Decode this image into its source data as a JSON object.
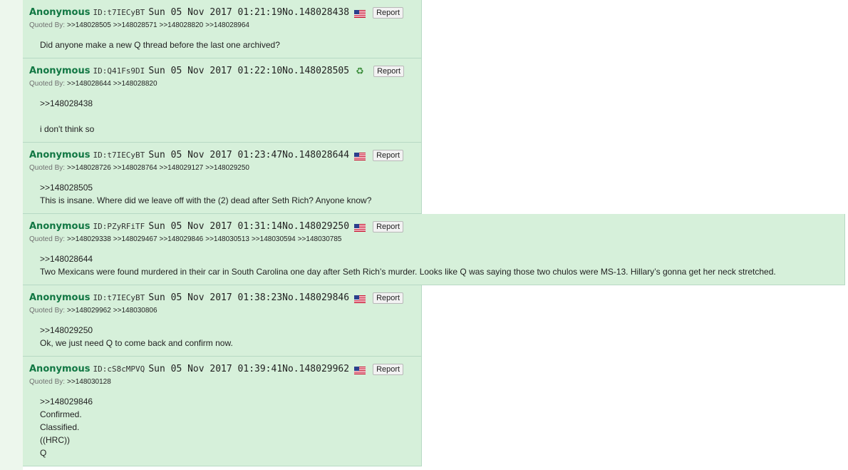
{
  "report_label": "Report",
  "quoted_by_label": "Quoted By:",
  "posts": [
    {
      "name": "Anonymous",
      "id": "ID:t7IECyBT",
      "datetime": "Sun 05 Nov 2017 01:21:19",
      "no": "No.148028438",
      "marker": "us-flag-icon",
      "quoted_by": [
        ">>148028505",
        ">>148028571",
        ">>148028820",
        ">>148028964"
      ],
      "lines": [
        "Did anyone make a new Q thread before the last one archived?"
      ]
    },
    {
      "name": "Anonymous",
      "id": "ID:Q41Fs9DI",
      "datetime": "Sun 05 Nov 2017 01:22:10",
      "no": "No.148028505",
      "marker": "recycle-icon",
      "quoted_by": [
        ">>148028644",
        ">>148028820"
      ],
      "lines": [
        ">>148028438",
        "",
        "i don't think so"
      ]
    },
    {
      "name": "Anonymous",
      "id": "ID:t7IECyBT",
      "datetime": "Sun 05 Nov 2017 01:23:47",
      "no": "No.148028644",
      "marker": "us-flag-icon",
      "quoted_by": [
        ">>148028726",
        ">>148028764",
        ">>148029127",
        ">>148029250"
      ],
      "lines": [
        ">>148028505",
        "This is insane. Where did we leave off with the (2) dead after Seth Rich? Anyone know?"
      ]
    },
    {
      "name": "Anonymous",
      "id": "ID:PZyRFiTF",
      "datetime": "Sun 05 Nov 2017 01:31:14",
      "no": "No.148029250",
      "marker": "us-flag-icon",
      "quoted_by": [
        ">>148029338",
        ">>148029467",
        ">>148029846",
        ">>148030513",
        ">>148030594",
        ">>148030785"
      ],
      "lines": [
        ">>148028644",
        "Two Mexicans were found murdered in their car in South Carolina one day after Seth Rich’s murder. Looks like Q was saying those two chulos were MS-13. Hillary’s gonna get her neck stretched."
      ]
    },
    {
      "name": "Anonymous",
      "id": "ID:t7IECyBT",
      "datetime": "Sun 05 Nov 2017 01:38:23",
      "no": "No.148029846",
      "marker": "us-flag-icon",
      "quoted_by": [
        ">>148029962",
        ">>148030806"
      ],
      "lines": [
        ">>148029250",
        "Ok, we just need Q to come back and confirm now."
      ]
    },
    {
      "name": "Anonymous",
      "id": "ID:cS8cMPVQ",
      "datetime": "Sun 05 Nov 2017 01:39:41",
      "no": "No.148029962",
      "marker": "us-flag-icon",
      "quoted_by": [
        ">>148030128"
      ],
      "lines": [
        ">>148029846",
        "Confirmed.",
        "Classified.",
        "((HRC))",
        "Q"
      ]
    }
  ]
}
